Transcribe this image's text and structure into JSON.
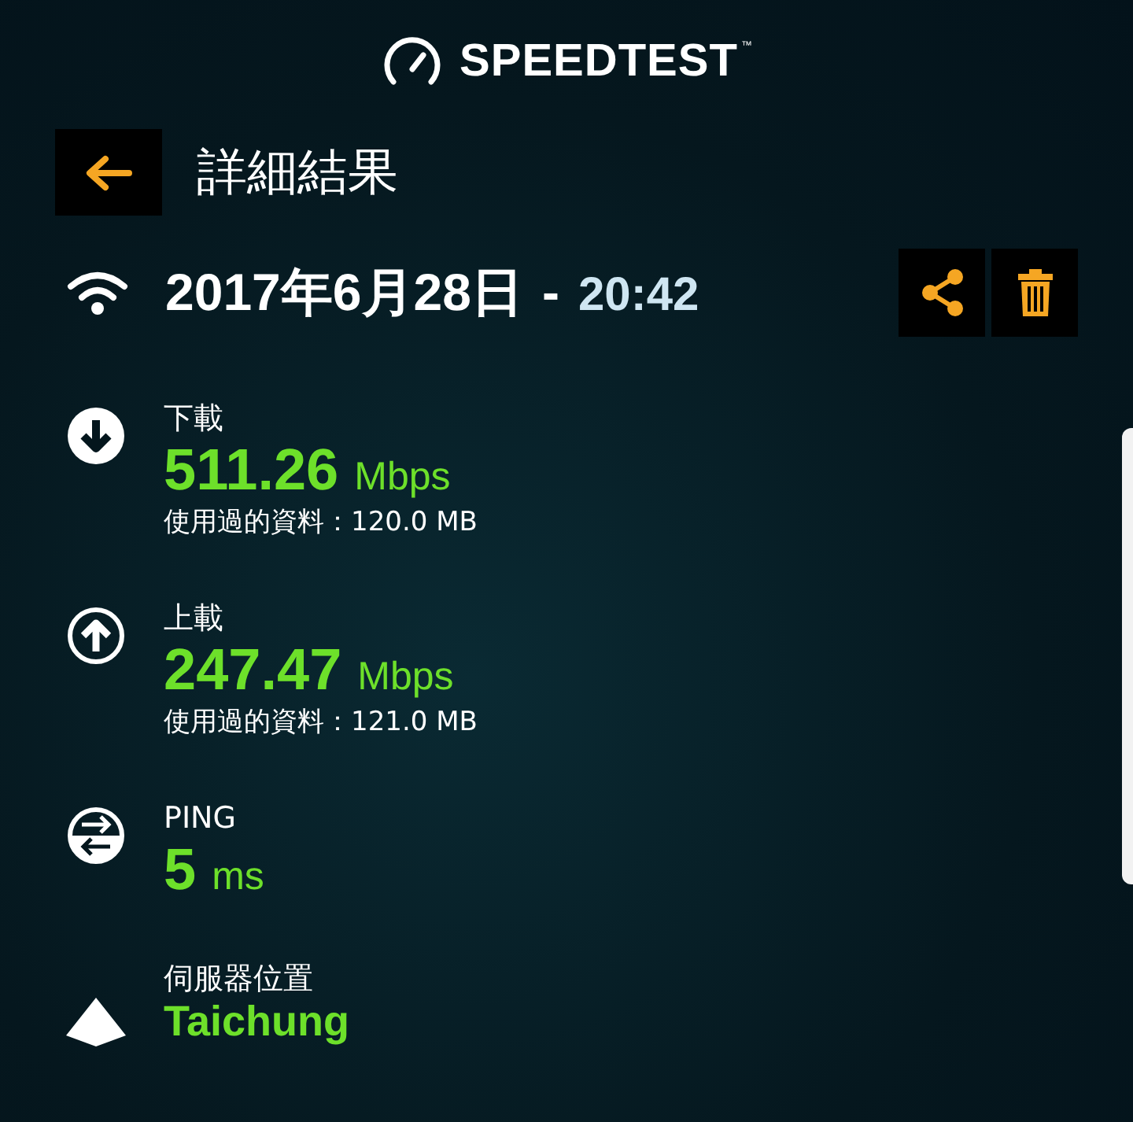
{
  "logo": {
    "text": "SPEEDTEST",
    "mark": "™"
  },
  "header": {
    "title": "詳細結果"
  },
  "result": {
    "date": "2017年6月28日",
    "separator": "-",
    "time": "20:42"
  },
  "metrics": [
    {
      "kind": "download",
      "label": "下載",
      "value": "511.26",
      "unit": "Mbps",
      "note": "使用過的資料：120.0 MB"
    },
    {
      "kind": "upload",
      "label": "上載",
      "value": "247.47",
      "unit": "Mbps",
      "note": "使用過的資料：121.0 MB"
    },
    {
      "kind": "ping",
      "label": "PING",
      "value": "5",
      "unit": "ms"
    },
    {
      "kind": "server",
      "label": "伺服器位置",
      "value": "Taichung"
    }
  ]
}
